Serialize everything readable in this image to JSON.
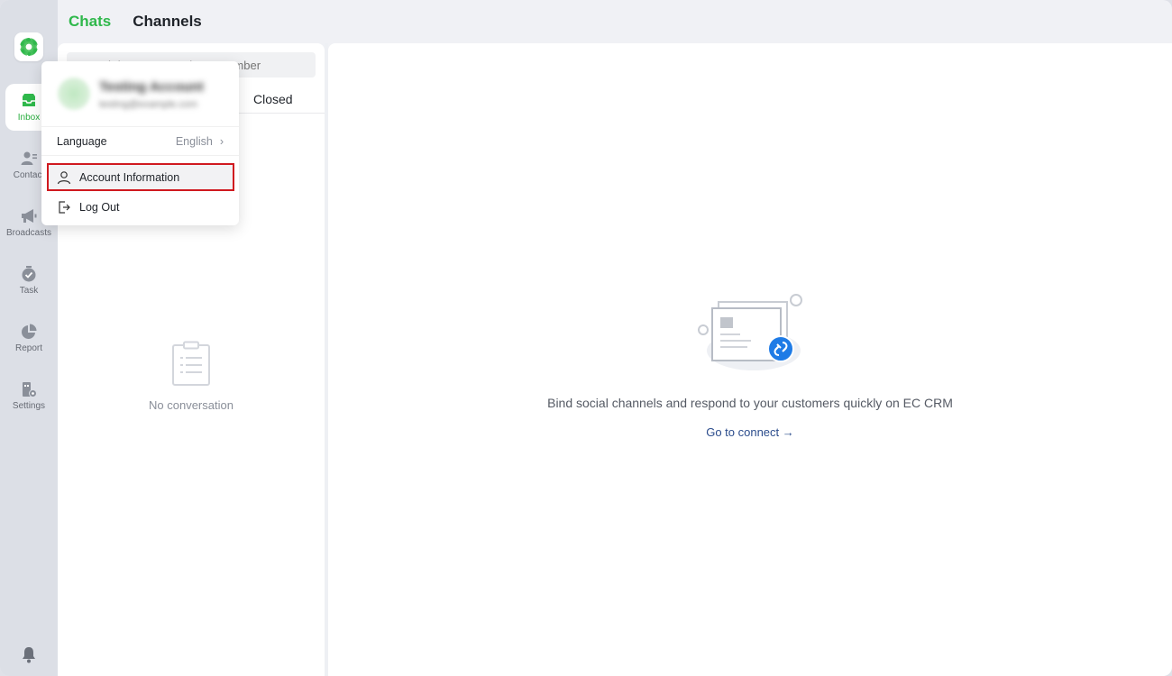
{
  "top_tabs": [
    {
      "label": "Chats",
      "active": true
    },
    {
      "label": "Channels",
      "active": false
    }
  ],
  "rail": {
    "items": [
      {
        "label": "Inbox",
        "icon": "inbox-icon",
        "active": true
      },
      {
        "label": "Contact",
        "icon": "contacts-icon"
      },
      {
        "label": "Broadcasts",
        "icon": "megaphone-icon"
      },
      {
        "label": "Task",
        "icon": "task-icon"
      },
      {
        "label": "Report",
        "icon": "pie-chart-icon"
      },
      {
        "label": "Settings",
        "icon": "settings-icon"
      }
    ]
  },
  "list": {
    "search_placeholder": "Search by Name or Phone Number",
    "status_tab_closed": "Closed",
    "empty_text": "No conversation"
  },
  "main": {
    "bind_text": "Bind social channels and respond to your customers quickly on EC CRM",
    "connect_label": "Go to connect",
    "connect_arrow": "→"
  },
  "popover": {
    "account_name": "Testing Account",
    "account_email": "testing@example.com",
    "language_label": "Language",
    "language_value": "English",
    "language_chevron": "›",
    "account_info_label": "Account Information",
    "logout_label": "Log Out"
  },
  "colors": {
    "accent_green": "#2fb84b",
    "highlight_red": "#d0191f",
    "link_blue": "#2b4c8c",
    "badge_blue": "#1e7be6"
  }
}
